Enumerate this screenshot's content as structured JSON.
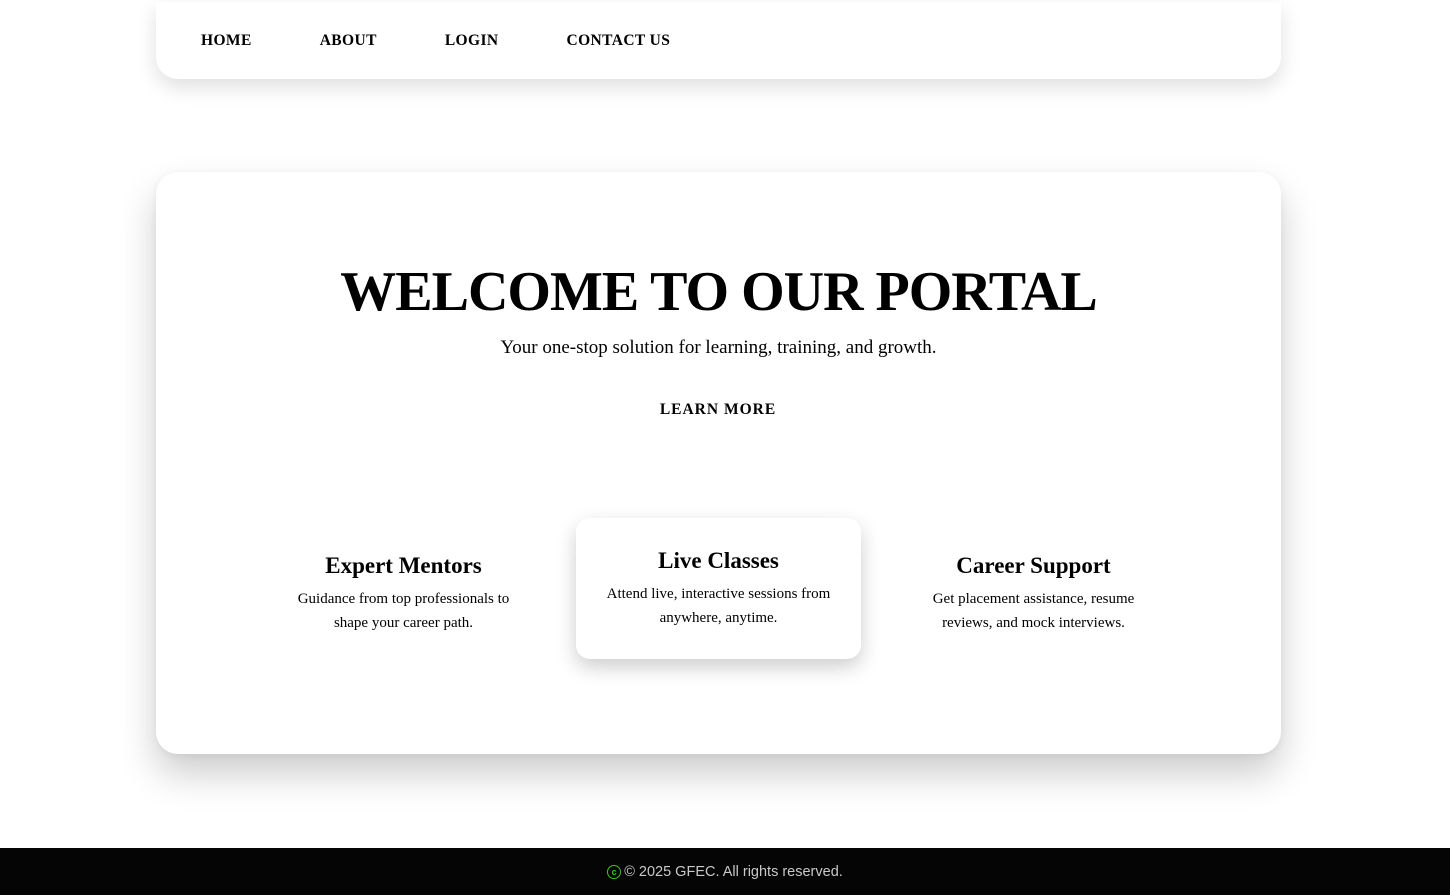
{
  "nav": {
    "items": [
      {
        "label": "HOME"
      },
      {
        "label": "ABOUT"
      },
      {
        "label": "LOGIN"
      },
      {
        "label": "CONTACT US"
      }
    ]
  },
  "hero": {
    "title": "WELCOME TO OUR PORTAL",
    "subtitle": "Your one-stop solution for learning, training, and growth.",
    "cta_label": "LEARN MORE"
  },
  "features": [
    {
      "title": "Expert Mentors",
      "description": "Guidance from top professionals to shape your career path."
    },
    {
      "title": "Live Classes",
      "description": "Attend live, interactive sessions from anywhere, anytime."
    },
    {
      "title": "Career Support",
      "description": "Get placement assistance, resume reviews, and mock interviews."
    }
  ],
  "footer": {
    "icon": "copyright-icon",
    "text": "© 2025 GFEC. All rights reserved.",
    "icon_color": "#3ec41a",
    "background": "#050505"
  }
}
